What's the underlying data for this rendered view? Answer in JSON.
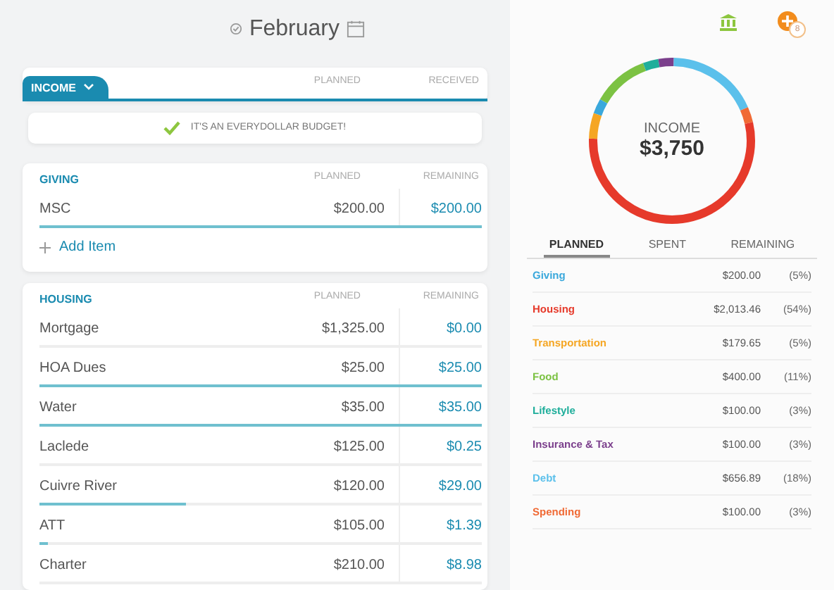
{
  "header": {
    "month": "February"
  },
  "income": {
    "title": "INCOME",
    "columns": [
      "PLANNED",
      "RECEIVED"
    ],
    "message": "IT'S AN EVERYDOLLAR BUDGET!"
  },
  "groups": [
    {
      "title": "GIVING",
      "columns": [
        "PLANNED",
        "REMAINING"
      ],
      "add_label": "Add Item",
      "items": [
        {
          "name": "MSC",
          "planned": "$200.00",
          "remaining": "$200.00",
          "level": 1
        }
      ]
    },
    {
      "title": "HOUSING",
      "columns": [
        "PLANNED",
        "REMAINING"
      ],
      "items": [
        {
          "name": "Mortgage",
          "planned": "$1,325.00",
          "remaining": "$0.00"
        },
        {
          "name": "HOA Dues",
          "planned": "$25.00",
          "remaining": "$25.00",
          "level": 1
        },
        {
          "name": "Water",
          "planned": "$35.00",
          "remaining": "$35.00",
          "level": 1
        },
        {
          "name": "Laclede",
          "planned": "$125.00",
          "remaining": "$0.25"
        },
        {
          "name": "Cuivre River",
          "planned": "$120.00",
          "remaining": "$29.00",
          "level": 0.33
        },
        {
          "name": "ATT",
          "planned": "$105.00",
          "remaining": "$1.39",
          "level": 0.02
        },
        {
          "name": "Charter",
          "planned": "$210.00",
          "remaining": "$8.98"
        }
      ]
    }
  ],
  "topbar": {
    "badge": "8"
  },
  "summary": {
    "label": "INCOME",
    "amount": "$3,750",
    "tabs": [
      {
        "label": "PLANNED",
        "selected": true
      },
      {
        "label": "SPENT",
        "selected": false
      },
      {
        "label": "REMAINING",
        "selected": false
      }
    ],
    "rows": [
      {
        "name": "Giving",
        "amount": "$200.00",
        "percent": "(5%)",
        "color": "#3aa8dc"
      },
      {
        "name": "Housing",
        "amount": "$2,013.46",
        "percent": "(54%)",
        "color": "#e63a2b"
      },
      {
        "name": "Transportation",
        "amount": "$179.65",
        "percent": "(5%)",
        "color": "#f5a623"
      },
      {
        "name": "Food",
        "amount": "$400.00",
        "percent": "(11%)",
        "color": "#7cc243"
      },
      {
        "name": "Lifestyle",
        "amount": "$100.00",
        "percent": "(3%)",
        "color": "#1fae9b"
      },
      {
        "name": "Insurance & Tax",
        "amount": "$100.00",
        "percent": "(3%)",
        "color": "#7b3f8c"
      },
      {
        "name": "Debt",
        "amount": "$656.89",
        "percent": "(18%)",
        "color": "#5bc0eb"
      },
      {
        "name": "Spending",
        "amount": "$100.00",
        "percent": "(3%)",
        "color": "#f06a35"
      }
    ]
  }
}
